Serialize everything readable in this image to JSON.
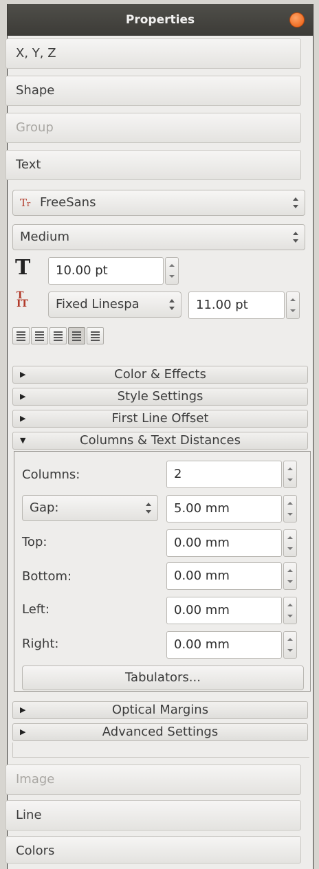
{
  "window": {
    "title": "Properties"
  },
  "sections": {
    "xyz": "X, Y, Z",
    "shape": "Shape",
    "group": "Group",
    "text": "Text",
    "image": "Image",
    "line": "Line",
    "colors": "Colors"
  },
  "font": {
    "family": "FreeSans",
    "style": "Medium"
  },
  "font_size": "10.00 pt",
  "linespacing": {
    "mode": "Fixed Linespa",
    "value": "11.00 pt"
  },
  "alignment": {
    "options": [
      "align-left",
      "align-center",
      "align-right",
      "justify",
      "force-justify"
    ],
    "active": "justify"
  },
  "expanders": {
    "color_effects": "Color & Effects",
    "style_settings": "Style Settings",
    "first_line_offset": "First Line Offset",
    "columns_text_distances": "Columns & Text Distances",
    "optical_margins": "Optical Margins",
    "advanced_settings": "Advanced Settings"
  },
  "columns": {
    "columns_label": "Columns:",
    "columns_value": "2",
    "gap_label": "Gap:",
    "gap_value": "5.00 mm",
    "top_label": "Top:",
    "top_value": "0.00 mm",
    "bottom_label": "Bottom:",
    "bottom_value": "0.00 mm",
    "left_label": "Left:",
    "left_value": "0.00 mm",
    "right_label": "Right:",
    "right_value": "0.00 mm",
    "tabulators_label": "Tabulators..."
  },
  "colors": {
    "titlebar": "#3c3b37",
    "close": "#e8590c",
    "panel_bg": "#eeedeb"
  }
}
